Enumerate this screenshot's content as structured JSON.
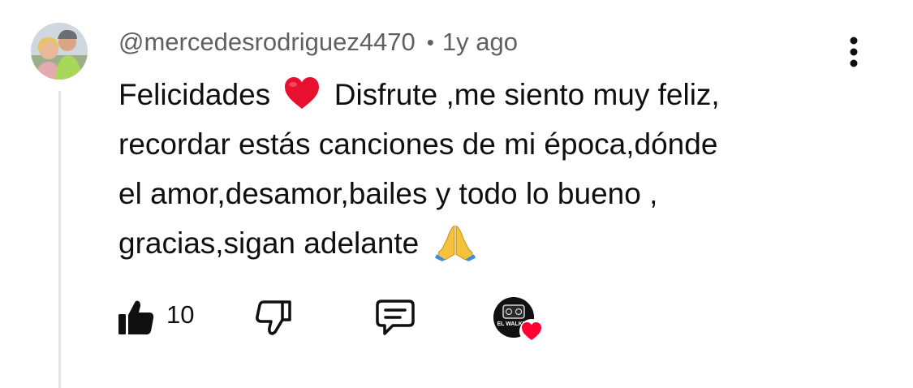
{
  "comment": {
    "author": "@mercedesrodriguez4470",
    "separator": "•",
    "time": "1y ago",
    "lines": [
      {
        "pre": "Felicidades ",
        "emoji": "red-heart",
        "post": " Disfrute ,me siento muy feliz,"
      },
      {
        "text": "recordar estás canciones de mi época,dónde"
      },
      {
        "text": "el amor,desamor,bailes y todo lo bueno ,"
      },
      {
        "pre": "gracias,sigan adelante ",
        "emoji": "folded-hands"
      }
    ]
  },
  "actions": {
    "like_count": "10",
    "like_icon": "thumbs-up-filled-icon",
    "dislike_icon": "thumbs-down-outline-icon",
    "reply_icon": "comment-bubble-icon",
    "creator_heart": {
      "channel_avatar_text": "EL WALKER",
      "heart_color": "#ff0033"
    }
  },
  "colors": {
    "text": "#0f0f0f",
    "meta": "#606060",
    "thread": "#e5e5e5"
  }
}
